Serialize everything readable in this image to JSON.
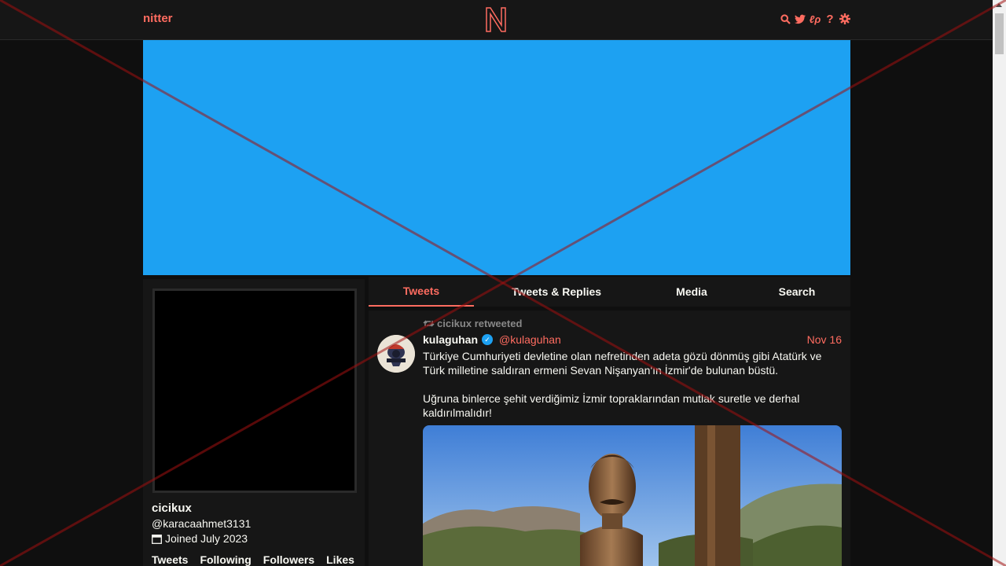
{
  "nav": {
    "brand": "nitter",
    "icons": [
      "search-icon",
      "twitter-bird-icon",
      "rss-icon",
      "help-icon",
      "gear-icon"
    ],
    "accent": "#ff6c60"
  },
  "banner": {
    "color": "#1da1f2"
  },
  "profile": {
    "name": "cicikux",
    "handle": "@karacaahmet3131",
    "joined": "Joined July 2023",
    "stats": [
      "Tweets",
      "Following",
      "Followers",
      "Likes"
    ]
  },
  "tabs": [
    {
      "label": "Tweets",
      "active": true
    },
    {
      "label": "Tweets & Replies",
      "active": false
    },
    {
      "label": "Media",
      "active": false
    },
    {
      "label": "Search",
      "active": false
    }
  ],
  "tweet": {
    "retweet_header": "cicikux retweeted",
    "fullname": "kulaguhan",
    "username": "@kulaguhan",
    "date": "Nov 16",
    "paragraphs": [
      "Türkiye Cumhuriyeti devletine olan nefretinden adeta gözü dönmüş gibi Atatürk ve Türk milletine saldıran ermeni Sevan Nişanyan'ın İzmir'de bulunan büstü.",
      "Uğruna binlerce şehit verdiğimiz İzmir topraklarından mutlak suretle ve derhal kaldırılmalıdır!"
    ]
  }
}
